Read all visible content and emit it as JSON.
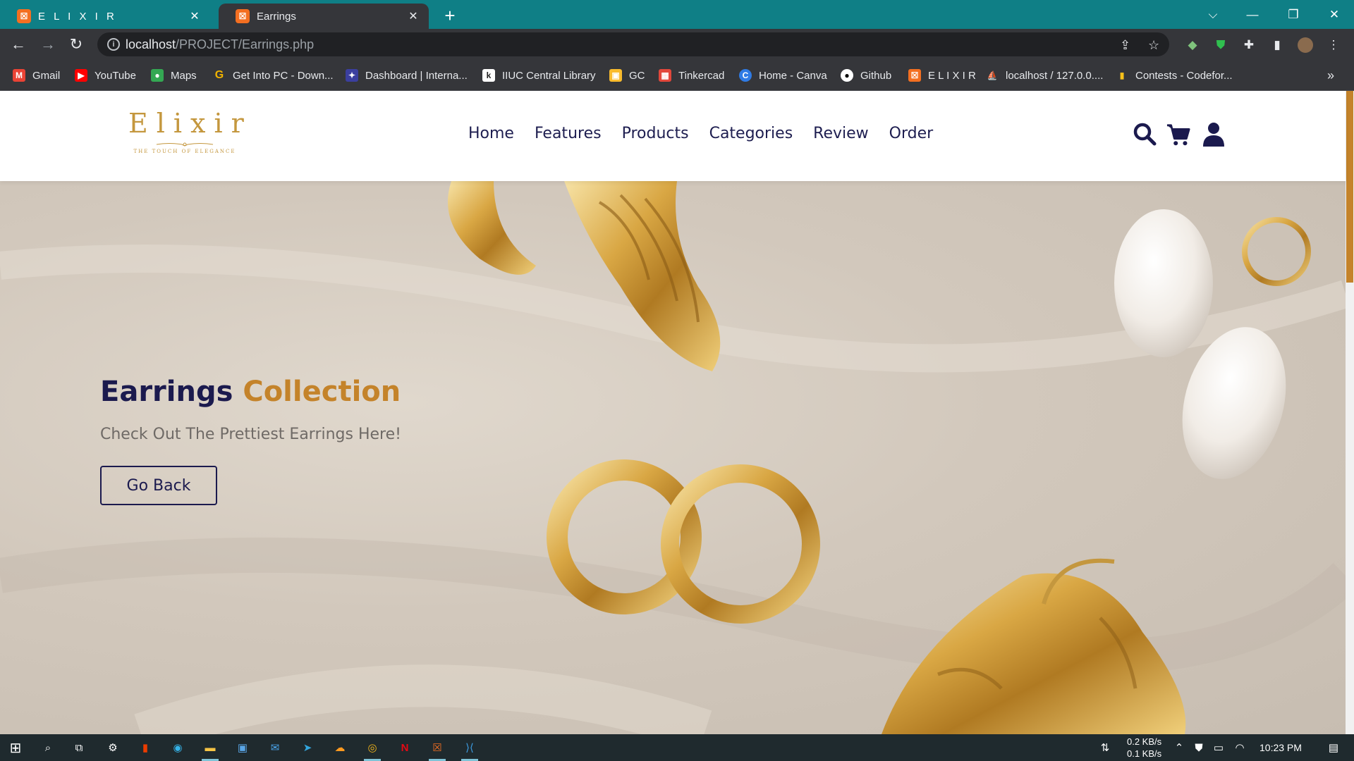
{
  "browser": {
    "tabs": [
      {
        "title": "E L I X I R",
        "active": false
      },
      {
        "title": "Earrings",
        "active": true
      }
    ],
    "url_host": "localhost",
    "url_path": "/PROJECT/Earrings.php",
    "bookmarks": [
      {
        "label": "Gmail",
        "icon": "gmail-icon"
      },
      {
        "label": "YouTube",
        "icon": "youtube-icon"
      },
      {
        "label": "Maps",
        "icon": "maps-icon"
      },
      {
        "label": "Get Into PC - Down...",
        "icon": "getintopc-icon"
      },
      {
        "label": "Dashboard | Interna...",
        "icon": "dashboard-icon"
      },
      {
        "label": "IIUC Central Library",
        "icon": "library-icon"
      },
      {
        "label": "GC",
        "icon": "classroom-icon"
      },
      {
        "label": "Tinkercad",
        "icon": "tinkercad-icon"
      },
      {
        "label": "Home - Canva",
        "icon": "canva-icon"
      },
      {
        "label": "Github",
        "icon": "github-icon"
      },
      {
        "label": "E L I X I R",
        "icon": "xampp-icon"
      },
      {
        "label": "localhost / 127.0.0....",
        "icon": "phpmyadmin-icon"
      },
      {
        "label": "Contests - Codefor...",
        "icon": "codeforces-icon"
      }
    ]
  },
  "site": {
    "logo_text": "Elixir",
    "logo_tagline": "THE TOUCH OF ELEGANCE",
    "nav": [
      "Home",
      "Features",
      "Products",
      "Categories",
      "Review",
      "Order"
    ],
    "hero": {
      "title_main": "Earrings",
      "title_accent": "Collection",
      "subtitle": "Check Out The Prettiest Earrings Here!",
      "button_label": "Go Back"
    },
    "colors": {
      "navy": "#1b1a4e",
      "gold": "#c4832a",
      "chrome_teal": "#0f7f86"
    }
  },
  "taskbar": {
    "net_down": "0.2 KB/s",
    "net_up": "0.1 KB/s",
    "time": "10:23 PM"
  }
}
